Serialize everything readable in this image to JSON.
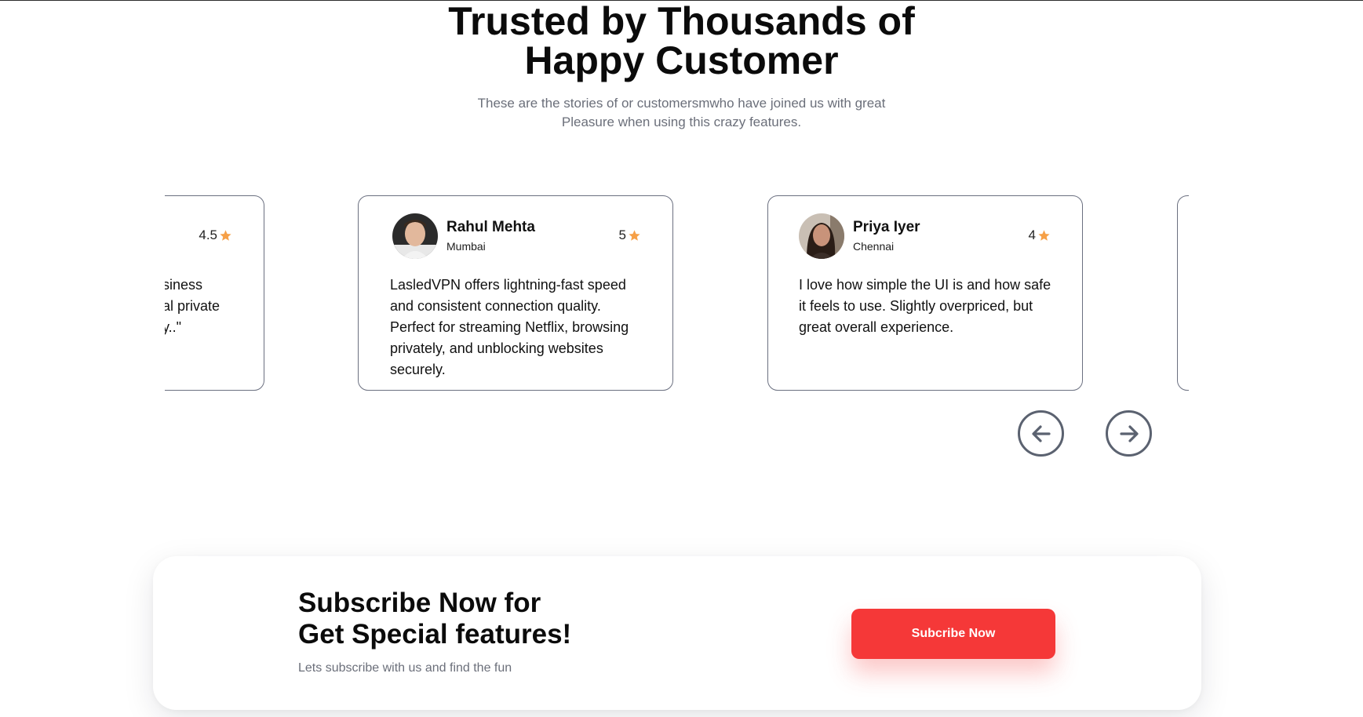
{
  "section": {
    "heading_line1": "Trusted by Thousands of",
    "heading_line2": "Happy Customer",
    "subtitle_line1": "These are the stories of or customersmwho have joined us with great",
    "subtitle_line2": "Pleasure when using this crazy features."
  },
  "testimonials": {
    "partial_left": {
      "rating": "4.5",
      "text_line1": "siness",
      "text_line2": "al private",
      "text_line3": "y..\""
    },
    "items": [
      {
        "name": "Rahul Mehta",
        "city": "Mumbai",
        "rating": "5",
        "text": "LasledVPN offers lightning-fast speed and consistent connection quality. Perfect for streaming Netflix, browsing privately, and unblocking websites securely."
      },
      {
        "name": "Priya Iyer",
        "city": "Chennai",
        "rating": "4",
        "text": "I love how simple the UI is and how safe it feels to use. Slightly overpriced, but great overall experience."
      }
    ],
    "star_icon": "star-icon",
    "prev_icon": "arrow-left-circle-icon",
    "next_icon": "arrow-right-circle-icon"
  },
  "subscribe": {
    "title_line1": "Subscribe Now for",
    "title_line2": "Get Special features!",
    "subtitle": "Lets subscribe with us and find the fun",
    "button_label": "Subcribe Now"
  },
  "colors": {
    "accent": "#f53838",
    "star": "#f6a047",
    "border": "#6b7080",
    "muted_text": "#6b6f7a"
  }
}
